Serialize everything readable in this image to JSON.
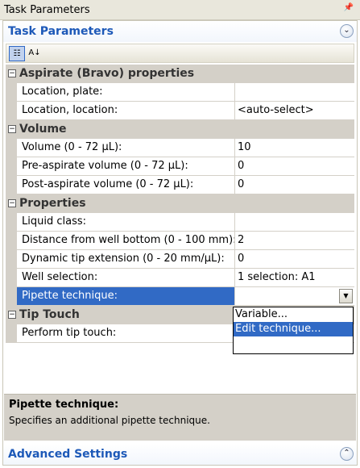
{
  "window": {
    "title": "Task Parameters",
    "pin_glyph": "📌"
  },
  "panel": {
    "header": "Task Parameters",
    "collapse_glyph": "⌄"
  },
  "toolbar": {
    "categorized_glyph": "☷",
    "alphabetical_glyph": "A↓"
  },
  "grid": {
    "categories": [
      {
        "label": "Aspirate (Bravo) properties",
        "rows": [
          {
            "name": "Location, plate:",
            "value": ""
          },
          {
            "name": "Location, location:",
            "value": "<auto-select>"
          }
        ]
      },
      {
        "label": "Volume",
        "rows": [
          {
            "name": "Volume (0 - 72 µL):",
            "value": "10"
          },
          {
            "name": "Pre-aspirate volume (0 - 72 µL):",
            "value": "0"
          },
          {
            "name": "Post-aspirate volume (0 - 72 µL):",
            "value": "0"
          }
        ]
      },
      {
        "label": "Properties",
        "rows": [
          {
            "name": "Liquid class:",
            "value": ""
          },
          {
            "name": "Distance from well bottom (0 - 100 mm):",
            "value": "2"
          },
          {
            "name": "Dynamic tip extension (0 - 20 mm/µL):",
            "value": "0"
          },
          {
            "name": "Well selection:",
            "value": "1 selection: A1"
          },
          {
            "name": "Pipette technique:",
            "value": ""
          }
        ]
      },
      {
        "label": "Tip Touch",
        "rows": [
          {
            "name": "Perform tip touch:",
            "value": ""
          }
        ]
      }
    ],
    "dropdown_options": [
      "Variable...",
      "Edit technique...",
      ""
    ],
    "expander_glyph": "−"
  },
  "help": {
    "title": "Pipette technique:",
    "description": "Specifies an additional pipette technique."
  },
  "advanced": {
    "header": "Advanced Settings",
    "expand_glyph": "⌃"
  },
  "colors": {
    "header_text": "#1d59b8",
    "selection": "#316ac5",
    "category_bg": "#d4d0c8"
  }
}
